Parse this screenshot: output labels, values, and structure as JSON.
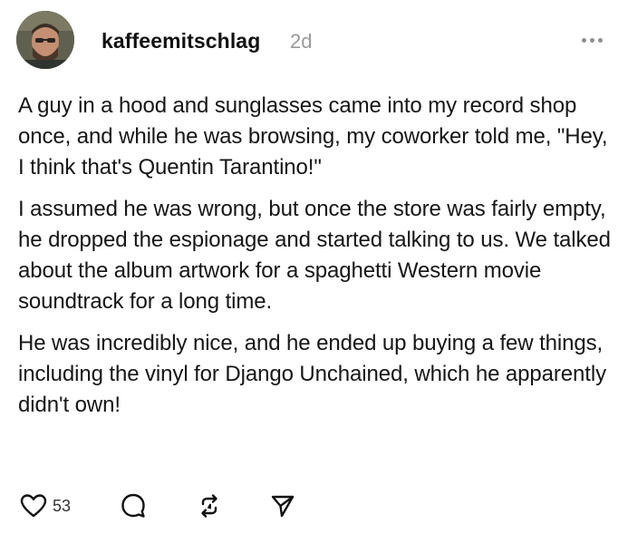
{
  "post": {
    "author": {
      "username": "kaffeemitschlag",
      "time_ago": "2d",
      "avatar_icon": "user-avatar"
    },
    "more_icon": "ellipsis-icon",
    "paragraphs": [
      "A guy in a hood and sunglasses came into my record shop once, and while he was browsing, my coworker told me, \"Hey, I think that's Quentin Tarantino!\"",
      "I assumed he was wrong, but once the store was fairly empty, he dropped the espionage and started talking to us. We talked about the album artwork for a spaghetti Western movie soundtrack for a long time.",
      "He was incredibly nice, and he ended up buying a few things, including the vinyl for Django Unchained, which he apparently didn't own!"
    ],
    "actions": {
      "like_count": "53",
      "like_icon": "heart-icon",
      "reply_icon": "comment-icon",
      "repost_icon": "repost-icon",
      "share_icon": "send-icon"
    }
  },
  "colors": {
    "text": "#161616",
    "muted": "#9a9a9a",
    "icon": "#111111",
    "background": "#ffffff"
  }
}
